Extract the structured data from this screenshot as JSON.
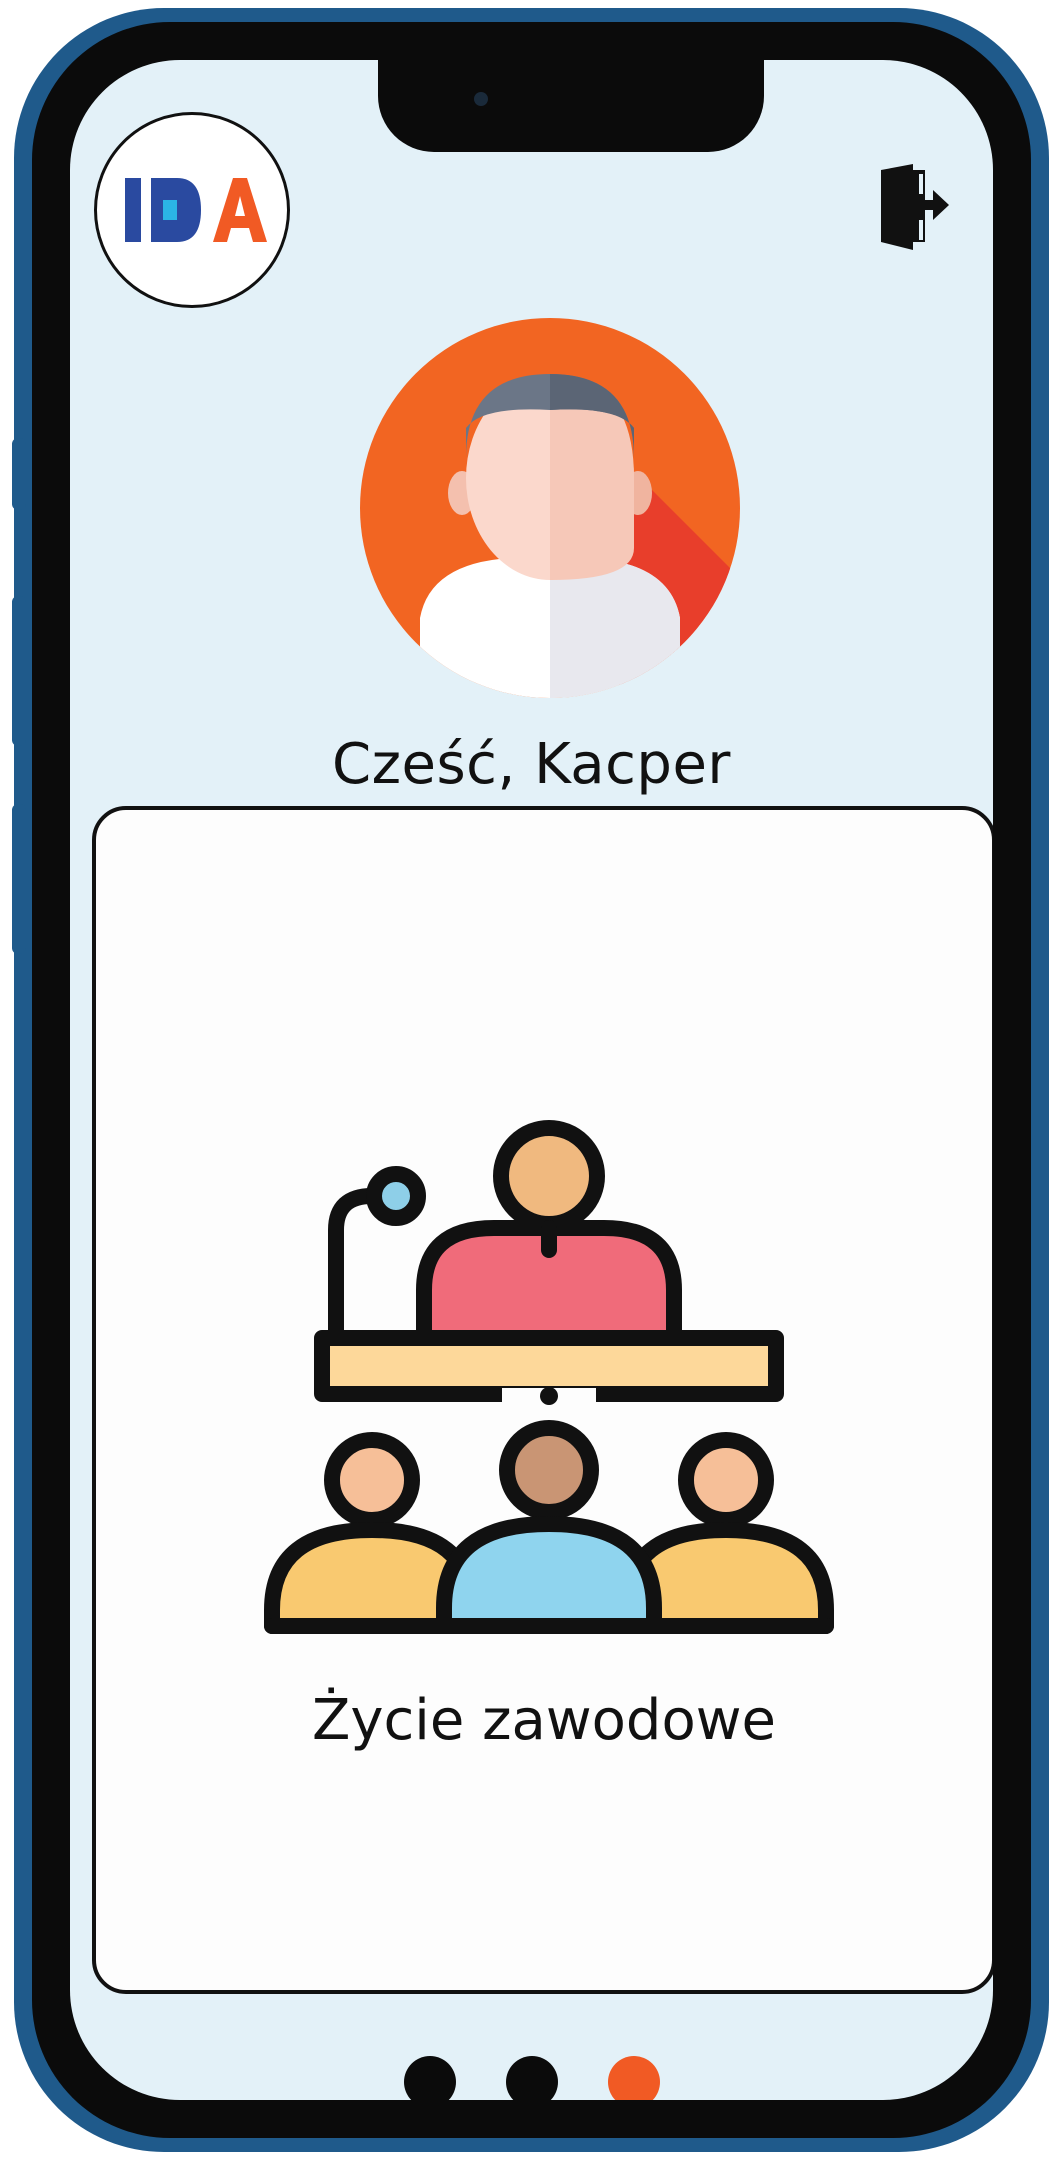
{
  "app": {
    "logo_text": "IDA",
    "greeting": "Cześć, Kacper"
  },
  "header": {
    "logout_icon": "logout-door-icon",
    "avatar_icon": "user-avatar-icon"
  },
  "card": {
    "title": "Życie zawodowe",
    "icon": "presentation-audience-icon"
  },
  "pager": {
    "count": 3,
    "active_index": 2
  },
  "colors": {
    "screen_bg": "#e3f1f8",
    "accent": "#f15a24",
    "frame": "#1f5a8b",
    "logo_blue": "#2a4aa0",
    "logo_cyan": "#2bb4e5"
  }
}
